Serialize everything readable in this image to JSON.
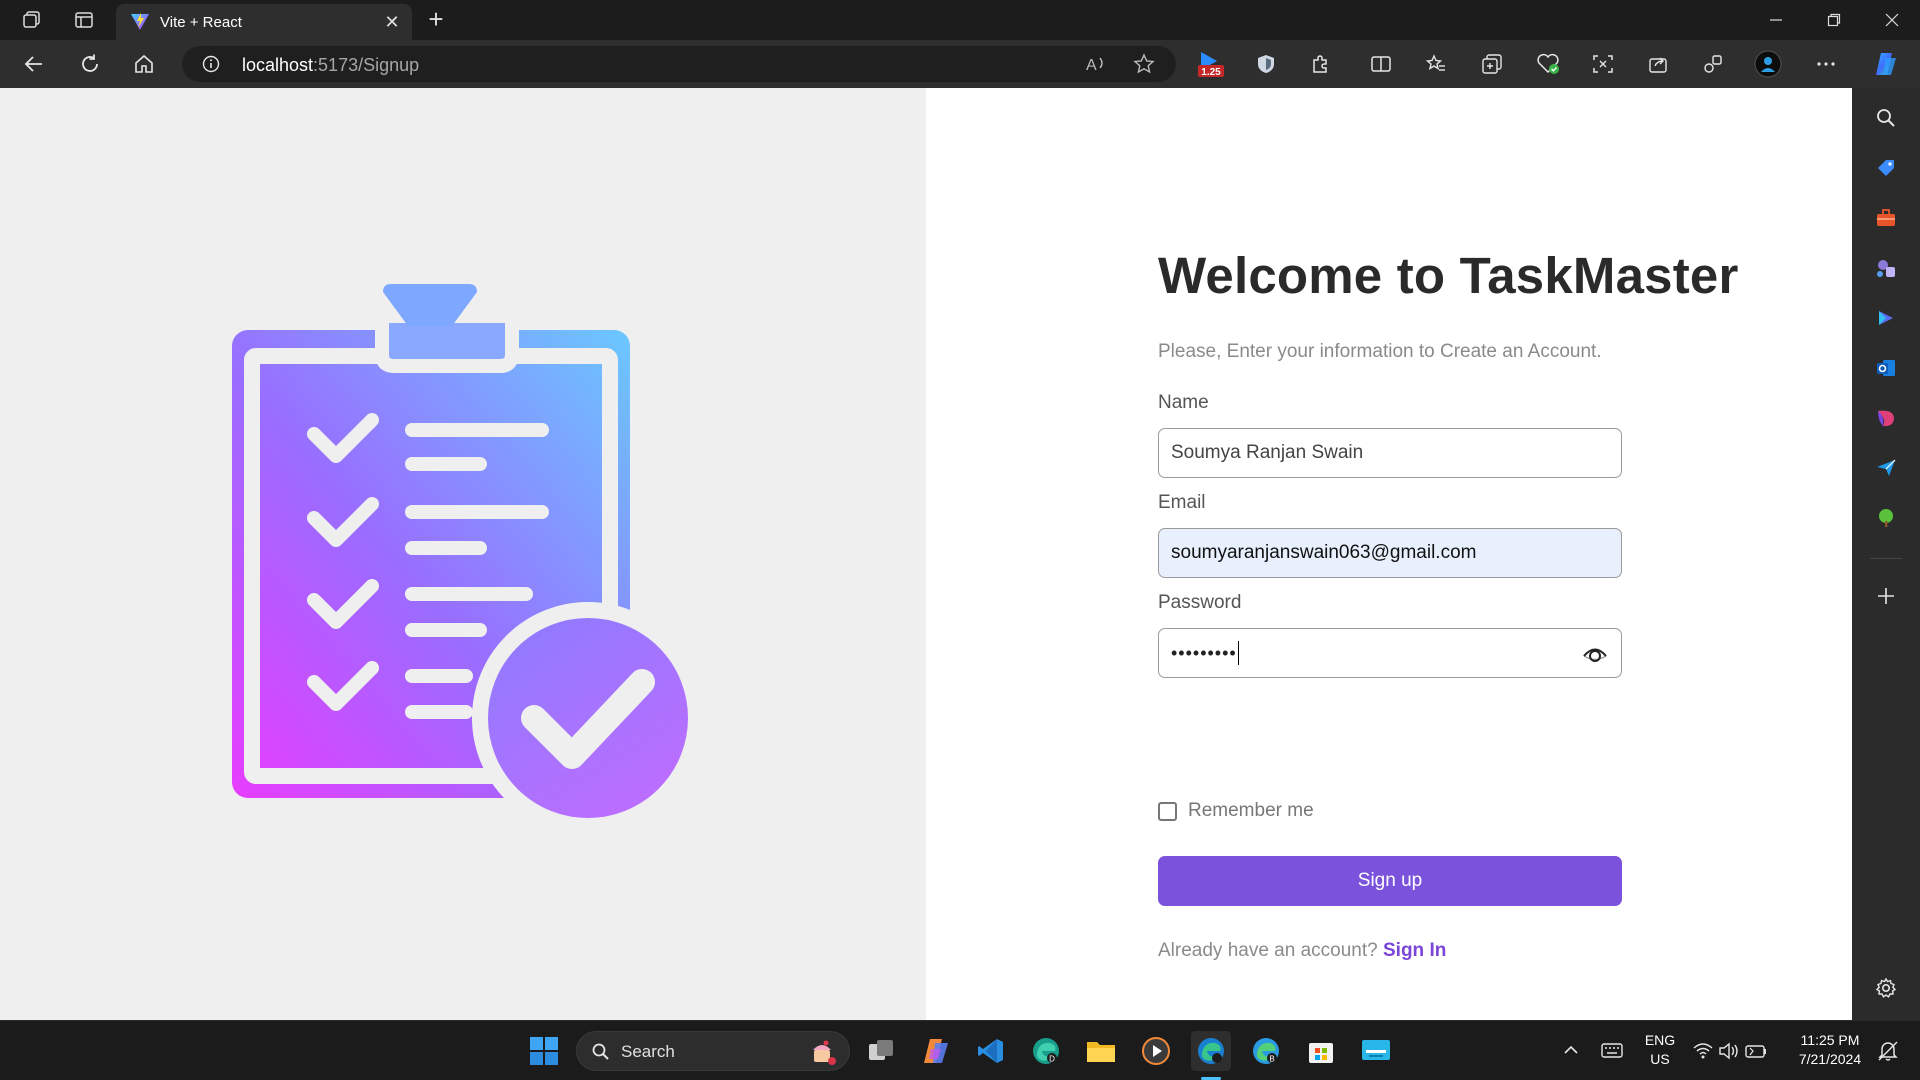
{
  "browser": {
    "tab_title": "Vite + React",
    "url_host": "localhost",
    "url_rest": ":5173/Signup",
    "extension_badge": "1.25"
  },
  "signup": {
    "heading": "Welcome to TaskMaster",
    "subtitle": "Please, Enter your information to Create an Account.",
    "name_label": "Name",
    "name_value": "Soumya Ranjan Swain",
    "email_label": "Email",
    "email_value": "soumyaranjanswain063@gmail.com",
    "password_label": "Password",
    "password_mask": "•••••••••",
    "remember_label": "Remember me",
    "submit_label": "Sign up",
    "already_text": "Already have an account?",
    "signin_label": "Sign In"
  },
  "taskbar": {
    "search_placeholder": "Search",
    "lang_top": "ENG",
    "lang_bottom": "US",
    "time": "11:25 PM",
    "date": "7/21/2024"
  },
  "colors": {
    "accent": "#7a52db",
    "link": "#7a45d8",
    "gradient_top": "#6ac8ff",
    "gradient_bottom": "#e83cff"
  }
}
